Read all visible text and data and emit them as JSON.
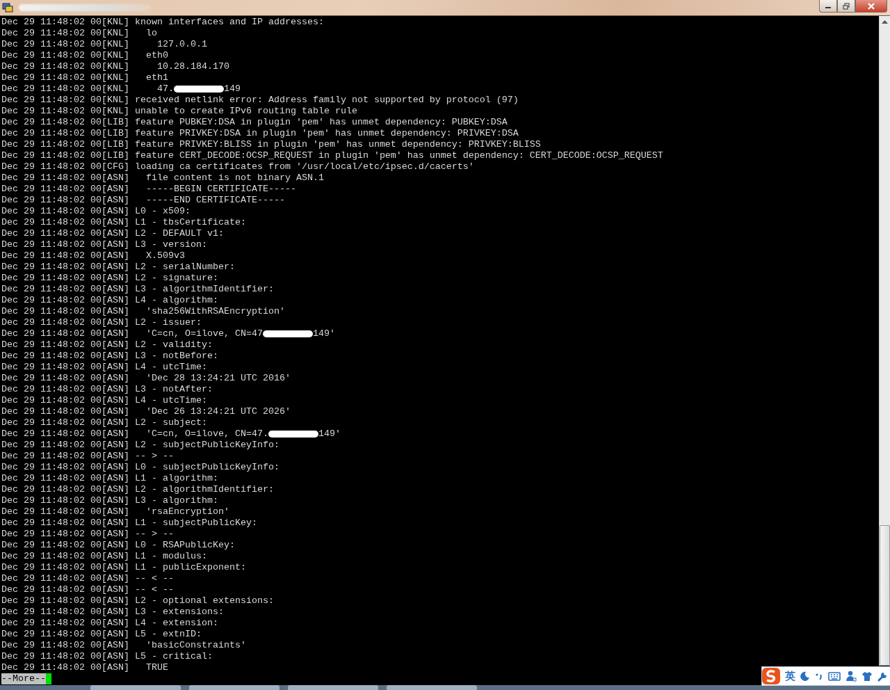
{
  "terminal": {
    "lines": [
      {
        "text": "Dec 29 11:48:02 00[KNL] known interfaces and IP addresses:"
      },
      {
        "text": "Dec 29 11:48:02 00[KNL]   lo"
      },
      {
        "text": "Dec 29 11:48:02 00[KNL]     127.0.0.1"
      },
      {
        "text": "Dec 29 11:48:02 00[KNL]   eth0"
      },
      {
        "text": "Dec 29 11:48:02 00[KNL]     10.28.184.170"
      },
      {
        "text": "Dec 29 11:48:02 00[KNL]   eth1"
      },
      {
        "text": "Dec 29 11:48:02 00[KNL]     47.",
        "redacted": true,
        "after": "149"
      },
      {
        "text": "Dec 29 11:48:02 00[KNL] received netlink error: Address family not supported by protocol (97)"
      },
      {
        "text": "Dec 29 11:48:02 00[KNL] unable to create IPv6 routing table rule"
      },
      {
        "text": "Dec 29 11:48:02 00[LIB] feature PUBKEY:DSA in plugin 'pem' has unmet dependency: PUBKEY:DSA"
      },
      {
        "text": "Dec 29 11:48:02 00[LIB] feature PRIVKEY:DSA in plugin 'pem' has unmet dependency: PRIVKEY:DSA"
      },
      {
        "text": "Dec 29 11:48:02 00[LIB] feature PRIVKEY:BLISS in plugin 'pem' has unmet dependency: PRIVKEY:BLISS"
      },
      {
        "text": "Dec 29 11:48:02 00[LIB] feature CERT_DECODE:OCSP_REQUEST in plugin 'pem' has unmet dependency: CERT_DECODE:OCSP_REQUEST"
      },
      {
        "text": "Dec 29 11:48:02 00[CFG] loading ca certificates from '/usr/local/etc/ipsec.d/cacerts'"
      },
      {
        "text": "Dec 29 11:48:02 00[ASN]   file content is not binary ASN.1"
      },
      {
        "text": "Dec 29 11:48:02 00[ASN]   -----BEGIN CERTIFICATE-----"
      },
      {
        "text": "Dec 29 11:48:02 00[ASN]   -----END CERTIFICATE-----"
      },
      {
        "text": "Dec 29 11:48:02 00[ASN] L0 - x509:"
      },
      {
        "text": "Dec 29 11:48:02 00[ASN] L1 - tbsCertificate:"
      },
      {
        "text": "Dec 29 11:48:02 00[ASN] L2 - DEFAULT v1:"
      },
      {
        "text": "Dec 29 11:48:02 00[ASN] L3 - version:"
      },
      {
        "text": "Dec 29 11:48:02 00[ASN]   X.509v3"
      },
      {
        "text": "Dec 29 11:48:02 00[ASN] L2 - serialNumber:"
      },
      {
        "text": "Dec 29 11:48:02 00[ASN] L2 - signature:"
      },
      {
        "text": "Dec 29 11:48:02 00[ASN] L3 - algorithmIdentifier:"
      },
      {
        "text": "Dec 29 11:48:02 00[ASN] L4 - algorithm:"
      },
      {
        "text": "Dec 29 11:48:02 00[ASN]   'sha256WithRSAEncryption'"
      },
      {
        "text": "Dec 29 11:48:02 00[ASN] L2 - issuer:"
      },
      {
        "text": "Dec 29 11:48:02 00[ASN]   'C=cn, O=ilove, CN=47",
        "redacted": true,
        "after": "149'"
      },
      {
        "text": "Dec 29 11:48:02 00[ASN] L2 - validity:"
      },
      {
        "text": "Dec 29 11:48:02 00[ASN] L3 - notBefore:"
      },
      {
        "text": "Dec 29 11:48:02 00[ASN] L4 - utcTime:"
      },
      {
        "text": "Dec 29 11:48:02 00[ASN]   'Dec 28 13:24:21 UTC 2016'"
      },
      {
        "text": "Dec 29 11:48:02 00[ASN] L3 - notAfter:"
      },
      {
        "text": "Dec 29 11:48:02 00[ASN] L4 - utcTime:"
      },
      {
        "text": "Dec 29 11:48:02 00[ASN]   'Dec 26 13:24:21 UTC 2026'"
      },
      {
        "text": "Dec 29 11:48:02 00[ASN] L2 - subject:"
      },
      {
        "text": "Dec 29 11:48:02 00[ASN]   'C=cn, O=ilove, CN=47.",
        "redacted": true,
        "after": "149'"
      },
      {
        "text": "Dec 29 11:48:02 00[ASN] L2 - subjectPublicKeyInfo:"
      },
      {
        "text": "Dec 29 11:48:02 00[ASN] -- > --"
      },
      {
        "text": "Dec 29 11:48:02 00[ASN] L0 - subjectPublicKeyInfo:"
      },
      {
        "text": "Dec 29 11:48:02 00[ASN] L1 - algorithm:"
      },
      {
        "text": "Dec 29 11:48:02 00[ASN] L2 - algorithmIdentifier:"
      },
      {
        "text": "Dec 29 11:48:02 00[ASN] L3 - algorithm:"
      },
      {
        "text": "Dec 29 11:48:02 00[ASN]   'rsaEncryption'"
      },
      {
        "text": "Dec 29 11:48:02 00[ASN] L1 - subjectPublicKey:"
      },
      {
        "text": "Dec 29 11:48:02 00[ASN] -- > --"
      },
      {
        "text": "Dec 29 11:48:02 00[ASN] L0 - RSAPublicKey:"
      },
      {
        "text": "Dec 29 11:48:02 00[ASN] L1 - modulus:"
      },
      {
        "text": "Dec 29 11:48:02 00[ASN] L1 - publicExponent:"
      },
      {
        "text": "Dec 29 11:48:02 00[ASN] -- < --"
      },
      {
        "text": "Dec 29 11:48:02 00[ASN] -- < --"
      },
      {
        "text": "Dec 29 11:48:02 00[ASN] L2 - optional extensions:"
      },
      {
        "text": "Dec 29 11:48:02 00[ASN] L3 - extensions:"
      },
      {
        "text": "Dec 29 11:48:02 00[ASN] L4 - extension:"
      },
      {
        "text": "Dec 29 11:48:02 00[ASN] L5 - extnID:"
      },
      {
        "text": "Dec 29 11:48:02 00[ASN]   'basicConstraints'"
      },
      {
        "text": "Dec 29 11:48:02 00[ASN] L5 - critical:"
      },
      {
        "text": "Dec 29 11:48:02 00[ASN]   TRUE"
      }
    ],
    "pager_prompt": "--More--"
  },
  "ime_toolbar": {
    "language": "英"
  }
}
